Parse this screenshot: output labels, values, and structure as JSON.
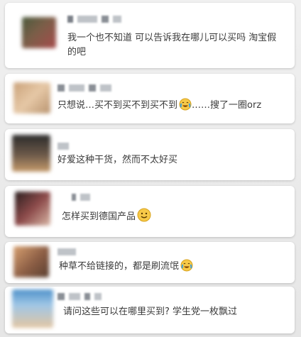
{
  "comments": [
    {
      "avatar_tone": "#6c5b4f",
      "text": "我一个也不知道 可以告诉我在哪儿可以买吗 淘宝假的吧"
    },
    {
      "avatar_tone": "#d8b48c",
      "text_before_emoji": "只想说…买不到买不到买不到",
      "emoji": "crying-laughing-icon",
      "text_after_emoji": "……搜了一圈orz"
    },
    {
      "avatar_tone": "#3d3630",
      "text": "好爱这种干货，然而不太好买"
    },
    {
      "avatar_tone": "#6e3b38",
      "text": "怎样买到德国产品",
      "emoji": "smile-icon"
    },
    {
      "avatar_tone": "#9b6c4f",
      "text": "种草不给链接的，都是刷流氓",
      "emoji": "crying-laughing-icon"
    },
    {
      "avatar_tone": "#4d90c9",
      "text": "请问这些可以在哪里买到? 学生党一枚飘过"
    }
  ]
}
